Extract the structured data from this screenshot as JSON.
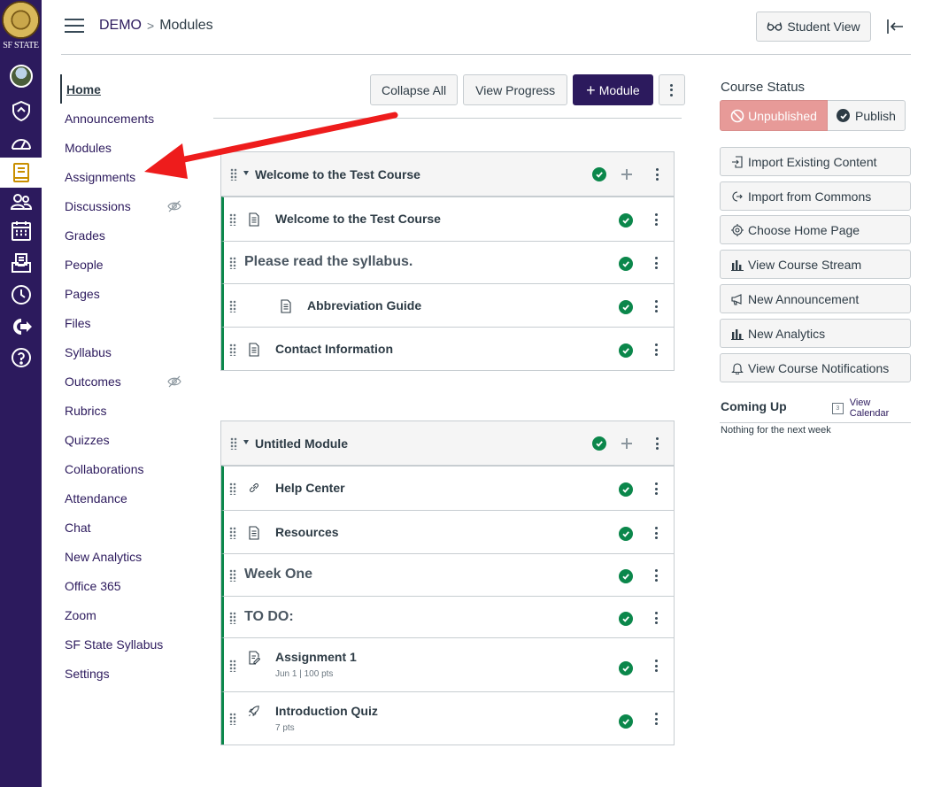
{
  "global_nav": {
    "institution": "SF STATE",
    "items": [
      {
        "name": "account-icon"
      },
      {
        "name": "admin-icon"
      },
      {
        "name": "dashboard-icon"
      },
      {
        "name": "courses-icon"
      },
      {
        "name": "groups-icon"
      },
      {
        "name": "calendar-icon"
      },
      {
        "name": "inbox-icon"
      },
      {
        "name": "history-icon"
      },
      {
        "name": "commons-icon"
      },
      {
        "name": "help-icon"
      }
    ]
  },
  "breadcrumb": {
    "course": "DEMO",
    "separator": ">",
    "current": "Modules"
  },
  "topbar": {
    "student_view": "Student View"
  },
  "course_nav": [
    {
      "label": "Home",
      "active": true
    },
    {
      "label": "Announcements"
    },
    {
      "label": "Modules"
    },
    {
      "label": "Assignments"
    },
    {
      "label": "Discussions",
      "hidden": true
    },
    {
      "label": "Grades"
    },
    {
      "label": "People"
    },
    {
      "label": "Pages"
    },
    {
      "label": "Files"
    },
    {
      "label": "Syllabus"
    },
    {
      "label": "Outcomes",
      "hidden": true
    },
    {
      "label": "Rubrics"
    },
    {
      "label": "Quizzes"
    },
    {
      "label": "Collaborations"
    },
    {
      "label": "Attendance"
    },
    {
      "label": "Chat"
    },
    {
      "label": "New Analytics"
    },
    {
      "label": "Office 365"
    },
    {
      "label": "Zoom"
    },
    {
      "label": "SF State Syllabus"
    },
    {
      "label": "Settings"
    }
  ],
  "toolbar": {
    "collapse_all": "Collapse All",
    "view_progress": "View Progress",
    "add_module": "Module"
  },
  "modules": [
    {
      "title": "Welcome to the Test Course",
      "items": [
        {
          "type": "page",
          "label": "Welcome to the Test Course"
        },
        {
          "type": "header",
          "label": "Please read the syllabus."
        },
        {
          "type": "page",
          "label": "Abbreviation Guide",
          "indent": true
        },
        {
          "type": "page",
          "label": "Contact Information"
        }
      ]
    },
    {
      "title": "Untitled Module",
      "items": [
        {
          "type": "link",
          "label": "Help Center"
        },
        {
          "type": "page",
          "label": "Resources"
        },
        {
          "type": "header",
          "label": "Week One"
        },
        {
          "type": "header",
          "label": "TO DO:"
        },
        {
          "type": "assignment",
          "label": "Assignment 1",
          "details": "Jun 1  |  100 pts"
        },
        {
          "type": "quiz",
          "label": "Introduction Quiz",
          "details": "7 pts"
        }
      ]
    }
  ],
  "sidebar": {
    "status_title": "Course Status",
    "unpublished": "Unpublished",
    "publish": "Publish",
    "actions": [
      {
        "label": "Import Existing Content",
        "icon": "import-icon"
      },
      {
        "label": "Import from Commons",
        "icon": "commons-icon"
      },
      {
        "label": "Choose Home Page",
        "icon": "target-icon"
      },
      {
        "label": "View Course Stream",
        "icon": "stats-icon"
      },
      {
        "label": "New Announcement",
        "icon": "announcement-icon"
      },
      {
        "label": "New Analytics",
        "icon": "stats-icon"
      },
      {
        "label": "View Course Notifications",
        "icon": "bell-icon"
      }
    ],
    "coming_up": "Coming Up",
    "view_calendar": "View Calendar",
    "calendar_day": "3",
    "nothing": "Nothing for the next week"
  },
  "colors": {
    "brand": "#2c1a5d",
    "success": "#0b874b",
    "unpublished": "#e79a98"
  }
}
